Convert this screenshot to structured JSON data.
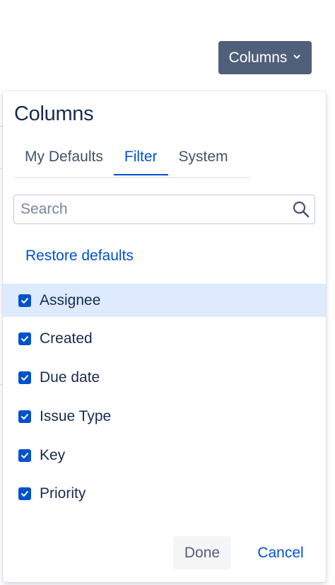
{
  "header": {
    "columns_button_label": "Columns",
    "columns_button_icon": "chevron-down-icon"
  },
  "dialog": {
    "title": "Columns",
    "tabs": [
      {
        "label": "My Defaults",
        "active": false
      },
      {
        "label": "Filter",
        "active": true
      },
      {
        "label": "System",
        "active": false
      }
    ],
    "search": {
      "value": "",
      "placeholder": "Search",
      "icon": "search-icon"
    },
    "restore_defaults_label": "Restore defaults",
    "columns": [
      {
        "label": "Assignee",
        "checked": true,
        "highlighted": true
      },
      {
        "label": "Created",
        "checked": true,
        "highlighted": false
      },
      {
        "label": "Due date",
        "checked": true,
        "highlighted": false
      },
      {
        "label": "Issue Type",
        "checked": true,
        "highlighted": false
      },
      {
        "label": "Key",
        "checked": true,
        "highlighted": false
      },
      {
        "label": "Priority",
        "checked": true,
        "highlighted": false
      }
    ],
    "done_label": "Done",
    "cancel_label": "Cancel"
  },
  "colors": {
    "primary_button_bg": "#505f79",
    "accent_blue": "#0052cc",
    "highlight_row_bg": "#deebff",
    "text_dark": "#172b4d"
  }
}
